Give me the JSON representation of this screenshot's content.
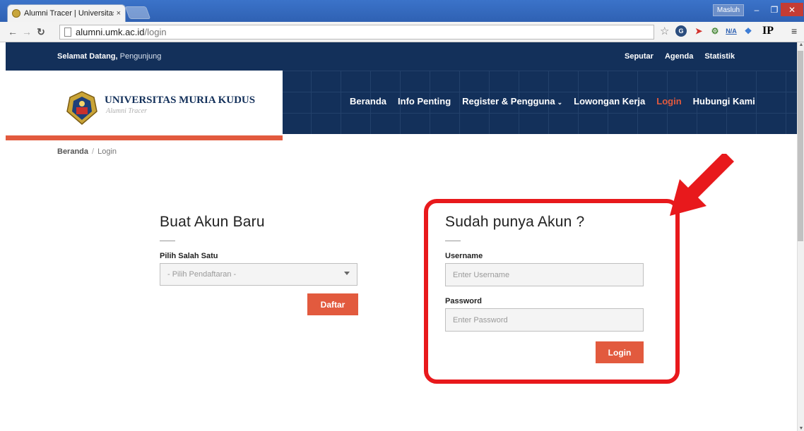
{
  "browser": {
    "tab_title": "Alumni Tracer | Universitas",
    "tab_close": "×",
    "user_name": "Masluh",
    "url_host": "alumni.umk.ac.id",
    "url_path": "/login",
    "ext_labels": [
      "N/A",
      "IP"
    ]
  },
  "site": {
    "welcome_prefix": "Selamat Datang,",
    "welcome_user": "Pengunjung",
    "top_links": [
      "Seputar",
      "Agenda",
      "Statistik"
    ],
    "brand_name": "UNIVERSITAS MURIA KUDUS",
    "brand_sub": "Alumni Tracer",
    "nav": {
      "beranda": "Beranda",
      "info": "Info Penting",
      "register": "Register & Pengguna",
      "lowongan": "Lowongan Kerja",
      "login": "Login",
      "hubungi": "Hubungi Kami"
    },
    "breadcrumb": {
      "home": "Beranda",
      "sep": "/",
      "current": "Login"
    }
  },
  "register": {
    "title": "Buat Akun Baru",
    "select_label": "Pilih Salah Satu",
    "select_value": "- Pilih Pendaftaran -",
    "button": "Daftar"
  },
  "login": {
    "title": "Sudah punya Akun ?",
    "username_label": "Username",
    "username_placeholder": "Enter Username",
    "password_label": "Password",
    "password_placeholder": "Enter Password",
    "button": "Login"
  },
  "colors": {
    "accent": "#e25a3e",
    "navy": "#13305a",
    "highlight": "#e8191c"
  }
}
